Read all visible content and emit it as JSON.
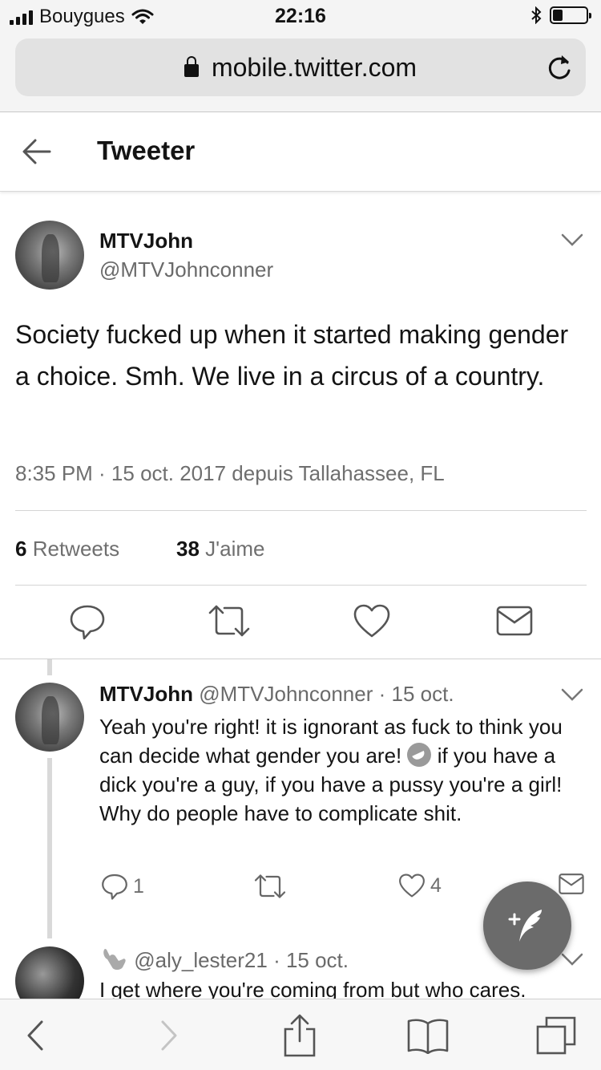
{
  "status_bar": {
    "carrier": "Bouygues",
    "time": "22:16",
    "battery_level": 0.3
  },
  "browser": {
    "url": "mobile.twitter.com"
  },
  "header": {
    "title": "Tweeter"
  },
  "main_tweet": {
    "name": "MTVJohn",
    "handle": "@MTVJohnconner",
    "text": "Society fucked up when it started making gender a choice. Smh. We live in a circus of a country.",
    "meta": "8:35 PM · 15 oct. 2017 depuis Tallahassee, FL",
    "retweets_count": "6",
    "retweets_label": "Retweets",
    "likes_count": "38",
    "likes_label": "J'aime"
  },
  "reply_1": {
    "name": "MTVJohn",
    "handle": "@MTVJohnconner",
    "date": "· 15 oct.",
    "text_before_emoji": "Yeah you're right! it is ignorant as fuck to think you can decide what gender you are! ",
    "text_after_emoji": " if you have a dick you're a guy, if you have a pussy you're a girl! Why do people have to complicate shit.",
    "reply_count": "1",
    "like_count": "4"
  },
  "reply_2": {
    "handle": "@aly_lester21",
    "date": "· 15 oct.",
    "text": "I get where you're coming from but who cares."
  },
  "icons": {
    "back": "arrow-left-icon",
    "reload": "reload-icon",
    "compose": "compose-tweet-icon"
  }
}
